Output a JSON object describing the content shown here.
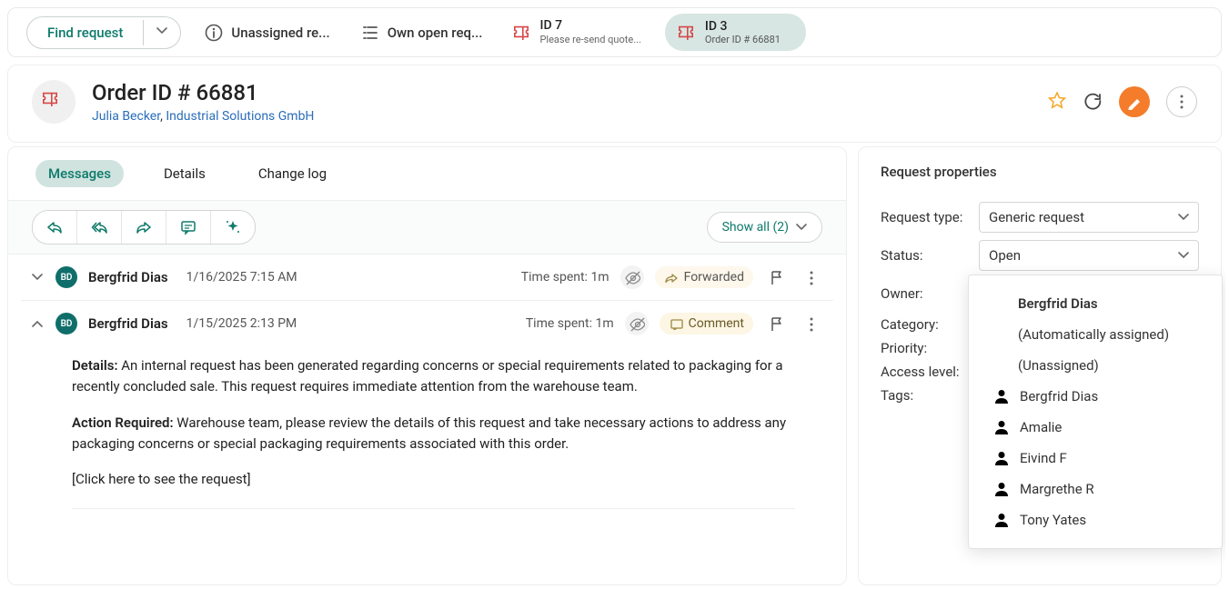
{
  "toolbar": {
    "find_label": "Find request",
    "unassigned": "Unassigned re...",
    "own_open": "Own open req...",
    "tab1_title": "ID 7",
    "tab1_sub": "Please re-send quote...",
    "tab2_title": "ID 3",
    "tab2_sub": "Order ID # 66881"
  },
  "header": {
    "title": "Order ID # 66881",
    "person": "Julia Becker",
    "company": "Industrial Solutions GmbH"
  },
  "tabs": {
    "messages": "Messages",
    "details": "Details",
    "change_log": "Change log"
  },
  "msg_toolbar": {
    "show_all": "Show all (2)"
  },
  "messages": [
    {
      "initials": "BD",
      "name": "Bergfrid Dias",
      "date": "1/16/2025 7:15 AM",
      "time_label": "Time spent:",
      "time_value": "1m",
      "tag": "Forwarded"
    },
    {
      "initials": "BD",
      "name": "Bergfrid Dias",
      "date": "1/15/2025 2:13 PM",
      "time_label": "Time spent:",
      "time_value": "1m",
      "tag": "Comment",
      "body": {
        "p1_label": "Details:",
        "p1_text": " An internal request has been generated regarding concerns or special requirements related to packaging for a recently concluded sale. This request requires immediate attention from the warehouse team.",
        "p2_label": "Action Required:",
        "p2_text": " Warehouse team, please review the details of this request and take necessary actions to address any packaging concerns or special packaging requirements associated with this order.",
        "p3": "[Click here to see the request]"
      }
    }
  ],
  "properties": {
    "panel_title": "Request properties",
    "labels": {
      "request_type": "Request type:",
      "status": "Status:",
      "owner": "Owner:",
      "category": "Category:",
      "priority": "Priority:",
      "access": "Access level:",
      "tags": "Tags:"
    },
    "values": {
      "request_type": "Generic request",
      "status": "Open",
      "owner": "Bergfrid Dias"
    }
  },
  "dropdown": {
    "selected": "Bergfrid Dias",
    "auto": "(Automatically assigned)",
    "unassigned": "(Unassigned)",
    "users": [
      "Bergfrid Dias",
      "Amalie",
      "Eivind F",
      "Margrethe R",
      "Tony Yates"
    ]
  }
}
